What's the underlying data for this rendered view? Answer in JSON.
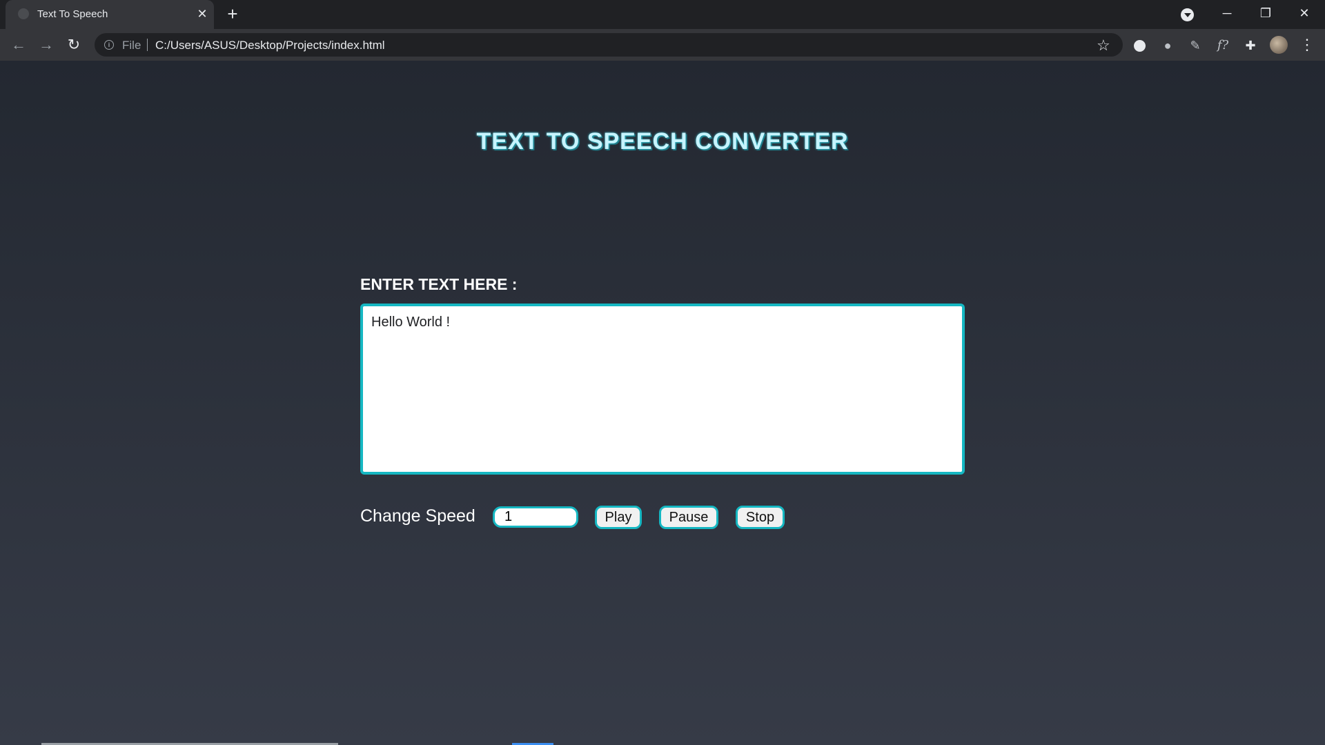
{
  "browser": {
    "tab_title": "Text To Speech",
    "close_glyph": "✕",
    "new_tab_glyph": "+",
    "omnibox": {
      "scheme": "File",
      "url": "C:/Users/ASUS/Desktop/Projects/index.html"
    },
    "window_controls": {
      "minimize": "─",
      "restore": "❐",
      "close": "✕"
    },
    "nav": {
      "back": "←",
      "forward": "→",
      "reload": "↻"
    },
    "star_glyph": "☆",
    "menu_glyph": "⋮",
    "extensions": [
      "puzzle-icon",
      "pen-icon",
      "function-icon",
      "dot-icon",
      "circle-icon"
    ]
  },
  "page": {
    "title": "TEXT TO SPEECH CONVERTER",
    "input_label": "ENTER TEXT HERE :",
    "text_value": "Hello World !",
    "speed_label": "Change Speed",
    "speed_value": "1",
    "play_label": "Play",
    "pause_label": "Pause",
    "stop_label": "Stop"
  },
  "colors": {
    "page_top": "#232831",
    "page_bottom": "#363b47",
    "accent": "#15b7c2",
    "title": "#c6f4ff"
  }
}
